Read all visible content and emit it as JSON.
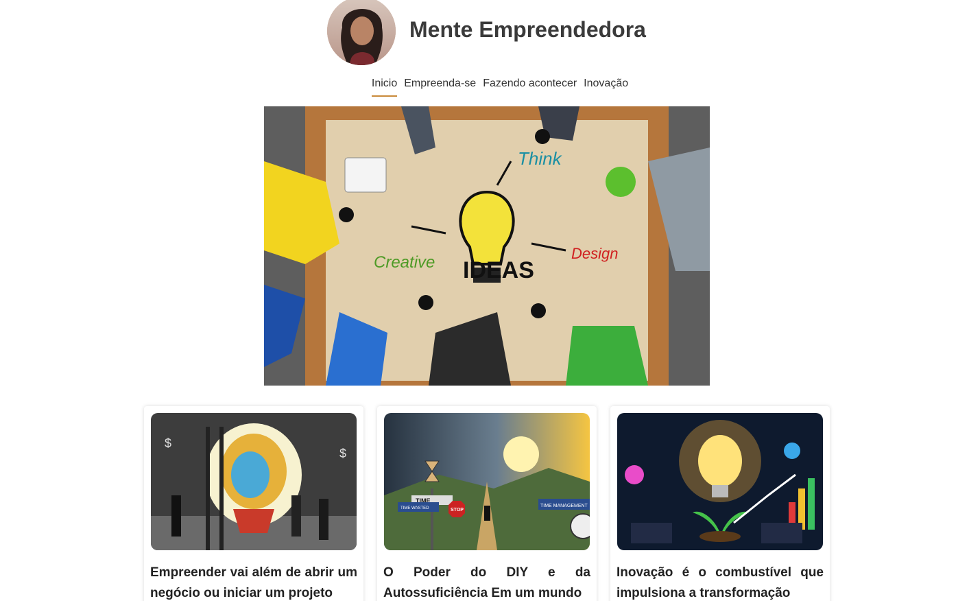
{
  "site": {
    "title": "Mente Empreendedora",
    "accent_color": "#c98a3a"
  },
  "nav": {
    "items": [
      {
        "label": "Inicio",
        "active": true
      },
      {
        "label": "Empreenda-se",
        "active": false
      },
      {
        "label": "Fazendo acontecer",
        "active": false
      },
      {
        "label": "Inovação",
        "active": false
      }
    ]
  },
  "hero": {
    "image_icon": "ideas-lightbulb-table-image",
    "words": [
      "Think",
      "Creative",
      "IDEAS",
      "Design"
    ]
  },
  "cards": [
    {
      "title": "Empreender vai além de abrir um negócio ou iniciar um projeto",
      "image_icon": "lightbulb-chalkboard-image"
    },
    {
      "title": "O Poder do DIY e da Autossuficiência Em um mundo",
      "image_icon": "time-management-road-image",
      "signs": [
        "TIME",
        "TIME WASTED",
        "STOP",
        "TIME MANAGEMENT"
      ]
    },
    {
      "title": "Inovação é o combustível que impulsiona a transformação",
      "image_icon": "innovation-lightbulb-growth-image"
    }
  ]
}
